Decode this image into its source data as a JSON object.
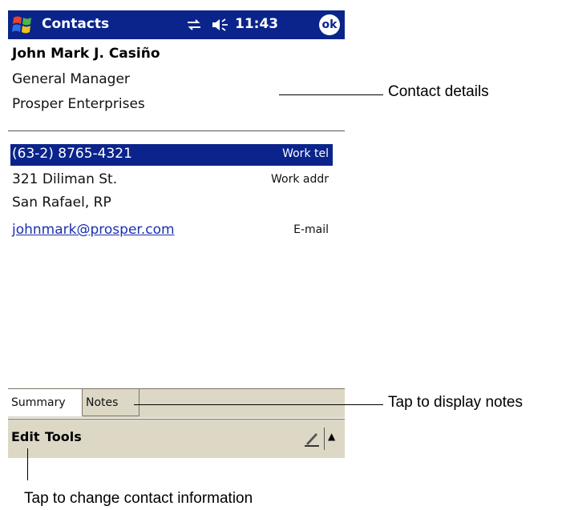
{
  "titlebar": {
    "app_title": "Contacts",
    "time": "11:43",
    "ok_label": "ok"
  },
  "contact": {
    "name": "John Mark J. Casiño",
    "job_title": "General Manager",
    "company": "Prosper Enterprises"
  },
  "fields": [
    {
      "value": "(63-2) 8765-4321",
      "label": "Work tel",
      "selected": true
    },
    {
      "value": "321 Diliman St.",
      "label": "Work addr"
    },
    {
      "value": "San Rafael, RP",
      "label": ""
    },
    {
      "value": "johnmark@prosper.com",
      "label": "E-mail",
      "link": true
    }
  ],
  "tabs": [
    {
      "label": "Summary",
      "active": true
    },
    {
      "label": "Notes",
      "active": false
    }
  ],
  "menubar": {
    "edit": "Edit",
    "tools": "Tools"
  },
  "callouts": {
    "contact_details": "Contact details",
    "display_notes": "Tap to display notes",
    "change_info": "Tap to change contact information"
  },
  "colors": {
    "titlebar": "#0a248b",
    "selection": "#0a248b",
    "bars": "#dcd8c5",
    "link": "#1a2fb0"
  }
}
